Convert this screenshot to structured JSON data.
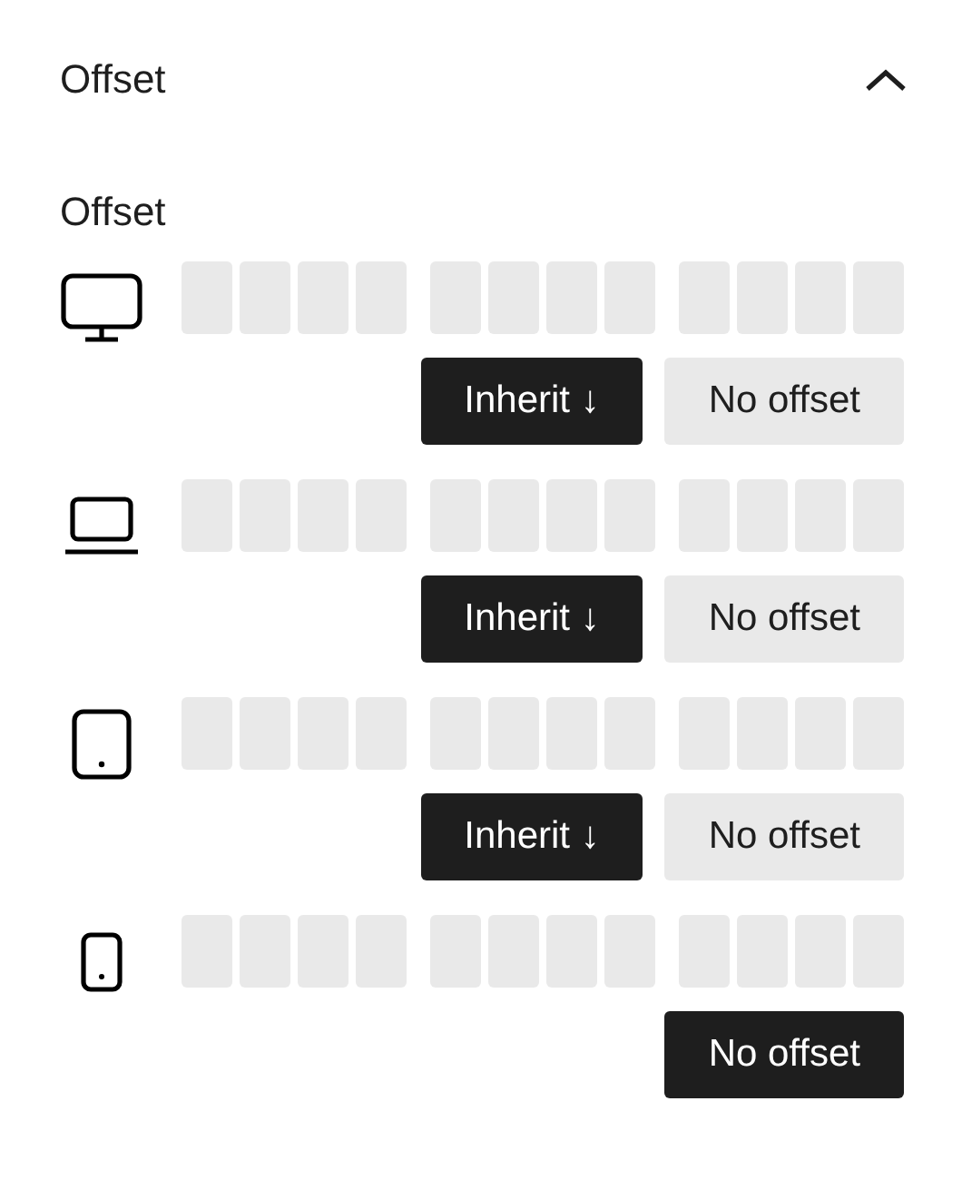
{
  "panel": {
    "title": "Offset",
    "expanded": true
  },
  "section_label": "Offset",
  "devices": [
    {
      "kind": "desktop",
      "buttons": [
        {
          "label": "Inherit ↓",
          "selected": true
        },
        {
          "label": "No offset",
          "selected": false
        }
      ]
    },
    {
      "kind": "laptop",
      "buttons": [
        {
          "label": "Inherit ↓",
          "selected": true
        },
        {
          "label": "No offset",
          "selected": false
        }
      ]
    },
    {
      "kind": "tablet",
      "buttons": [
        {
          "label": "Inherit ↓",
          "selected": true
        },
        {
          "label": "No offset",
          "selected": false
        }
      ]
    },
    {
      "kind": "phone",
      "buttons": [
        {
          "label": "No offset",
          "selected": true
        }
      ]
    }
  ]
}
